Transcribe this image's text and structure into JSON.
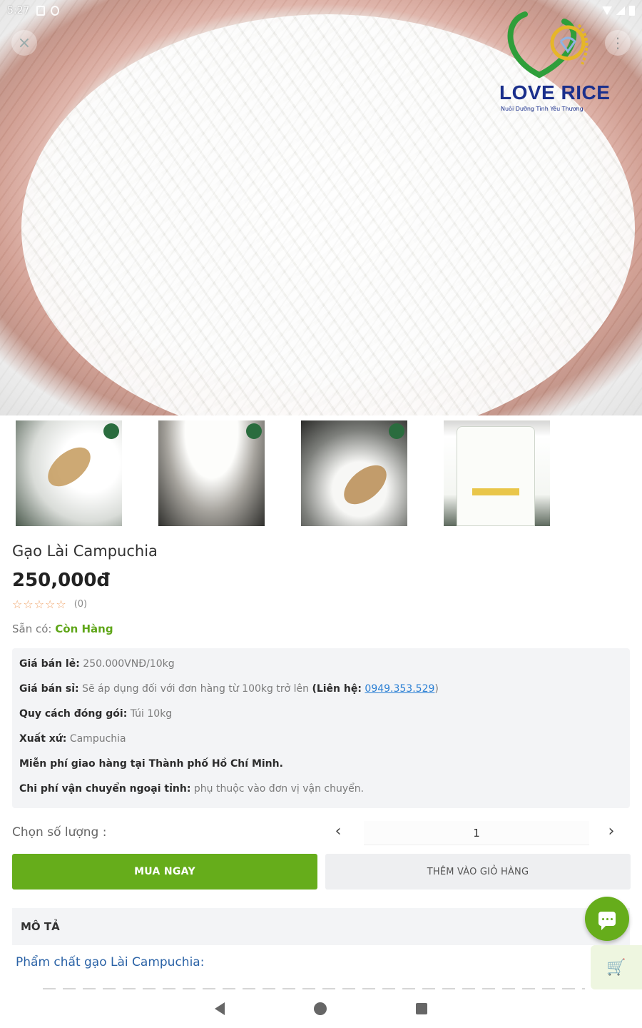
{
  "status_bar": {
    "time": "5:27"
  },
  "hero": {
    "brand_name": "LOVE RICE",
    "brand_tagline": "Nuôi Dưỡng Tình Yêu Thương"
  },
  "product": {
    "title": "Gạo Lài Campuchia",
    "price": "250,000đ",
    "rating_stars": 0,
    "rating_count": "(0)",
    "stock_label": "Sẵn có:",
    "stock_value": "Còn Hàng"
  },
  "details": {
    "retail_label": "Giá bán lẻ:",
    "retail_value": "250.000VNĐ/10kg",
    "wholesale_label": "Giá bán sỉ:",
    "wholesale_value": "Sẽ áp dụng đối với đơn hàng từ 100kg trở lên",
    "contact_label": "(Liên hệ:",
    "contact_phone": "0949.353.529",
    "contact_close": ")",
    "packing_label": "Quy cách đóng gói:",
    "packing_value": "Túi 10kg",
    "origin_label": "Xuất xứ:",
    "origin_value": "Campuchia",
    "free_shipping": "Miễn phí giao hàng tại Thành phố Hồ Chí Minh.",
    "shipping_label": "Chi phí vận chuyển ngoại tỉnh:",
    "shipping_value": "phụ thuộc vào đơn vị vận chuyển."
  },
  "quantity": {
    "label": "Chọn số lượng :",
    "value": "1",
    "prev_icon": "‹",
    "next_icon": "›"
  },
  "actions": {
    "buy_now": "MUA NGAY",
    "add_to_cart": "THÊM VÀO GIỎ HÀNG"
  },
  "description": {
    "header": "MÔ TẢ",
    "subtitle": "Phẩm chất gạo Lài Campuchia:"
  },
  "icons": {
    "close": "×",
    "more": "⋮",
    "star": "☆",
    "cart": "🛒"
  },
  "colors": {
    "accent": "#66ad1b",
    "link": "#2a7fd4",
    "brand": "#1a2f8c"
  }
}
